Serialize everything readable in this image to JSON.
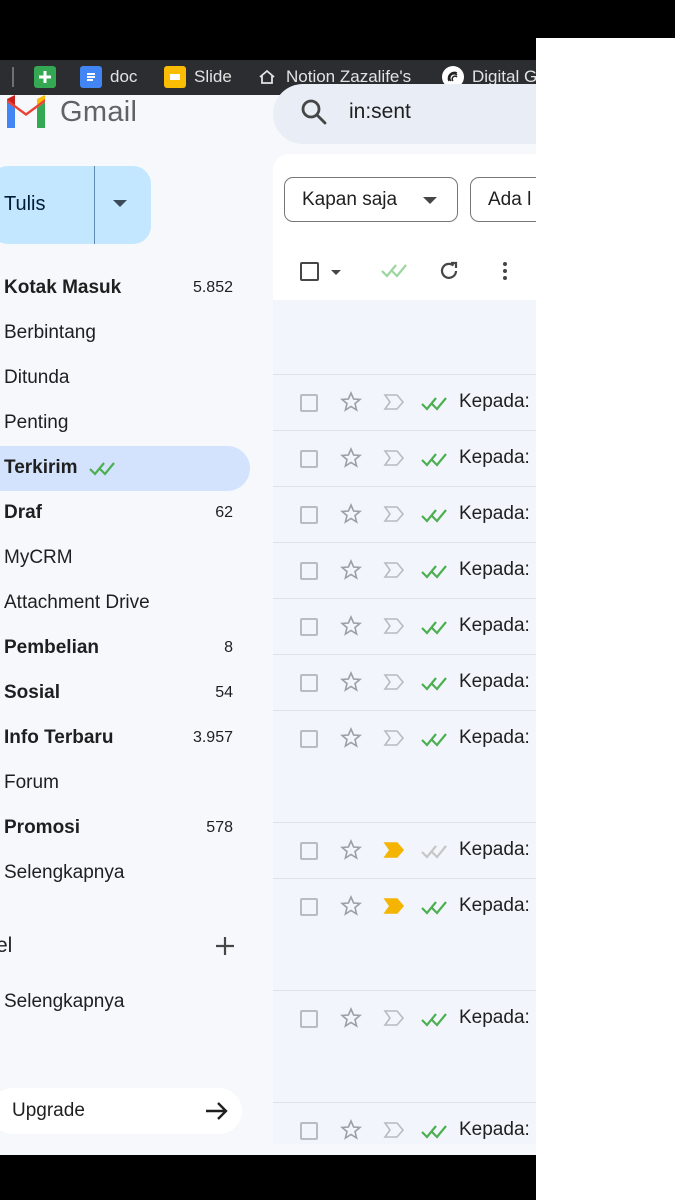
{
  "bookmarks": [
    {
      "label": "",
      "icon": "sheets-icon",
      "color": "#34a853"
    },
    {
      "label": "doc",
      "icon": "docs-icon",
      "color": "#4285f4"
    },
    {
      "label": "Slide",
      "icon": "slides-icon",
      "color": "#fbbc04"
    },
    {
      "label": "Notion Zazalife's",
      "icon": "home-icon"
    },
    {
      "label": "Digital G",
      "icon": "digital-icon"
    }
  ],
  "app": {
    "name": "Gmail"
  },
  "search": {
    "value": "in:sent"
  },
  "compose": {
    "label": "Tulis"
  },
  "sidebar": {
    "items": [
      {
        "label": "Kotak Masuk",
        "count": "5.852",
        "bold": true
      },
      {
        "label": "Berbintang",
        "count": "",
        "bold": false
      },
      {
        "label": "Ditunda",
        "count": "",
        "bold": false
      },
      {
        "label": "Penting",
        "count": "",
        "bold": false
      },
      {
        "label": "Terkirim",
        "count": "",
        "bold": true,
        "active": true
      },
      {
        "label": "Draf",
        "count": "62",
        "bold": true
      },
      {
        "label": "MyCRM",
        "count": "",
        "bold": false
      },
      {
        "label": "Attachment Drive",
        "count": "",
        "bold": false
      },
      {
        "label": "Pembelian",
        "count": "8",
        "bold": true
      },
      {
        "label": "Sosial",
        "count": "54",
        "bold": true
      },
      {
        "label": "Info Terbaru",
        "count": "3.957",
        "bold": true
      },
      {
        "label": "Forum",
        "count": "",
        "bold": false
      },
      {
        "label": "Promosi",
        "count": "578",
        "bold": true
      },
      {
        "label": "Selengkapnya",
        "count": "",
        "bold": false
      }
    ],
    "labels_header": "el",
    "labels_more": "Selengkapnya",
    "upgrade": "Upgrade"
  },
  "filters": {
    "time": "Kapan saja",
    "has": "Ada l"
  },
  "emails": [
    {
      "recipient": "Kepada:",
      "important": false,
      "read_ticks": "green"
    },
    {
      "recipient": "Kepada:",
      "important": false,
      "read_ticks": "green"
    },
    {
      "recipient": "Kepada:",
      "important": false,
      "read_ticks": "green"
    },
    {
      "recipient": "Kepada:",
      "important": false,
      "read_ticks": "green"
    },
    {
      "recipient": "Kepada:",
      "important": false,
      "read_ticks": "green"
    },
    {
      "recipient": "Kepada:",
      "important": false,
      "read_ticks": "green"
    },
    {
      "recipient": "Kepada:",
      "important": false,
      "read_ticks": "green"
    },
    {
      "recipient": "Kepada:",
      "important": true,
      "read_ticks": "gray"
    },
    {
      "recipient": "Kepada:",
      "important": true,
      "read_ticks": "green"
    },
    {
      "recipient": "Kepada:",
      "important": false,
      "read_ticks": "green"
    },
    {
      "recipient": "Kepada:",
      "important": false,
      "read_ticks": "green"
    }
  ],
  "colors": {
    "accent": "#d3e3fd",
    "compose": "#c2e7ff",
    "tick_green": "#4caf50",
    "important": "#f4b400"
  }
}
